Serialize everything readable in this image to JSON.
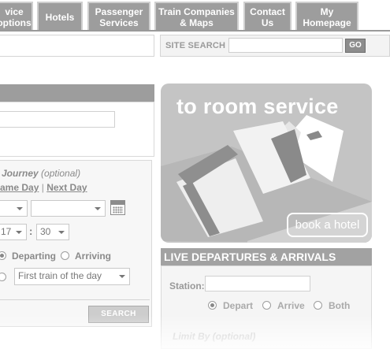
{
  "nav": {
    "tabs": [
      {
        "label": "vice\noptions"
      },
      {
        "label": "Hotels"
      },
      {
        "label": "Passenger\nServices"
      },
      {
        "label": "Train Companies\n& Maps"
      },
      {
        "label": "Contact\nUs"
      },
      {
        "label": "My\nHomepage"
      }
    ]
  },
  "site_search": {
    "label": "SITE SEARCH",
    "placeholder": "",
    "go_label": "GO"
  },
  "journey": {
    "return_title": "Journey",
    "return_optional": "(optional)",
    "same_day": "ame Day",
    "separator": "|",
    "next_day": "Next Day",
    "hour_value": "17",
    "minute_value": "30",
    "depart_label": "Departing",
    "arrive_label": "Arriving",
    "first_train_label": "First train of the day",
    "search_label": "SEARCH"
  },
  "banner": {
    "title": "to room service",
    "book_label": "book a hotel"
  },
  "live": {
    "heading": "LIVE DEPARTURES & ARRIVALS",
    "station_label": "Station:",
    "depart_label": "Depart",
    "arrive_label": "Arrive",
    "both_label": "Both",
    "limit_label": "Limit By (optional)"
  },
  "colors": {
    "tab_bg": "#9d9d9d",
    "panel_head": "#a2a2a2",
    "banner_bg": "#c4c4c4"
  }
}
